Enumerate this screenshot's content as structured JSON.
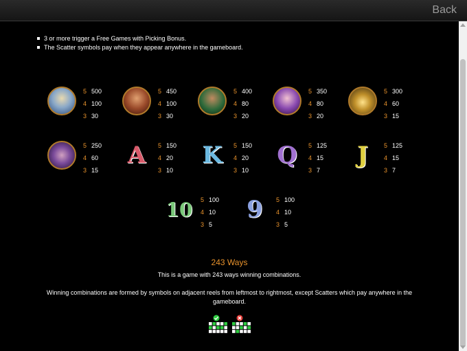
{
  "header": {
    "back_label": "Back"
  },
  "bullets": [
    "3 or more trigger a Free Games with Picking Bonus.",
    "The Scatter symbols pay when they appear anywhere in the gameboard."
  ],
  "symbols": [
    {
      "icon": "king-portrait-icon",
      "pays": [
        {
          "count": "5",
          "value": "500"
        },
        {
          "count": "4",
          "value": "100"
        },
        {
          "count": "3",
          "value": "30"
        }
      ]
    },
    {
      "icon": "warrior-portrait-icon",
      "pays": [
        {
          "count": "5",
          "value": "450"
        },
        {
          "count": "4",
          "value": "100"
        },
        {
          "count": "3",
          "value": "30"
        }
      ]
    },
    {
      "icon": "rogue-portrait-icon",
      "pays": [
        {
          "count": "5",
          "value": "400"
        },
        {
          "count": "4",
          "value": "80"
        },
        {
          "count": "3",
          "value": "20"
        }
      ]
    },
    {
      "icon": "queen-portrait-icon",
      "pays": [
        {
          "count": "5",
          "value": "350"
        },
        {
          "count": "4",
          "value": "80"
        },
        {
          "count": "3",
          "value": "20"
        }
      ]
    },
    {
      "icon": "golden-palace-icon",
      "pays": [
        {
          "count": "5",
          "value": "300"
        },
        {
          "count": "4",
          "value": "60"
        },
        {
          "count": "3",
          "value": "15"
        }
      ]
    },
    {
      "icon": "ship-icon",
      "pays": [
        {
          "count": "5",
          "value": "250"
        },
        {
          "count": "4",
          "value": "60"
        },
        {
          "count": "3",
          "value": "15"
        }
      ]
    },
    {
      "icon": "letter-a-icon",
      "glyph": "A",
      "color": "#d85a6a",
      "pays": [
        {
          "count": "5",
          "value": "150"
        },
        {
          "count": "4",
          "value": "20"
        },
        {
          "count": "3",
          "value": "10"
        }
      ]
    },
    {
      "icon": "letter-k-icon",
      "glyph": "K",
      "color": "#6ab8e0",
      "pays": [
        {
          "count": "5",
          "value": "150"
        },
        {
          "count": "4",
          "value": "20"
        },
        {
          "count": "3",
          "value": "10"
        }
      ]
    },
    {
      "icon": "letter-q-icon",
      "glyph": "Q",
      "color": "#a070d0",
      "pays": [
        {
          "count": "5",
          "value": "125"
        },
        {
          "count": "4",
          "value": "15"
        },
        {
          "count": "3",
          "value": "7"
        }
      ]
    },
    {
      "icon": "letter-j-icon",
      "glyph": "J",
      "color": "#e0d040",
      "pays": [
        {
          "count": "5",
          "value": "125"
        },
        {
          "count": "4",
          "value": "15"
        },
        {
          "count": "3",
          "value": "7"
        }
      ]
    },
    {
      "icon": "number-ten-icon",
      "glyph": "10",
      "color": "#7ac87a",
      "pays": [
        {
          "count": "5",
          "value": "100"
        },
        {
          "count": "4",
          "value": "10"
        },
        {
          "count": "3",
          "value": "5"
        }
      ]
    },
    {
      "icon": "number-nine-icon",
      "glyph": "9",
      "color": "#8aa0e0",
      "pays": [
        {
          "count": "5",
          "value": "100"
        },
        {
          "count": "4",
          "value": "10"
        },
        {
          "count": "3",
          "value": "5"
        }
      ]
    }
  ],
  "ways": {
    "title": "243 Ways",
    "line1": "This is a game with 243 ways winning combinations.",
    "line2": "Winning combinations are formed by symbols on adjacent reels from leftmost to rightmost, except Scatters which pay anywhere in the gameboard."
  },
  "colors": {
    "accent_orange": "#e8922c",
    "background": "#000000",
    "valid_green": "#2ecc40",
    "invalid_red": "#e53935"
  }
}
